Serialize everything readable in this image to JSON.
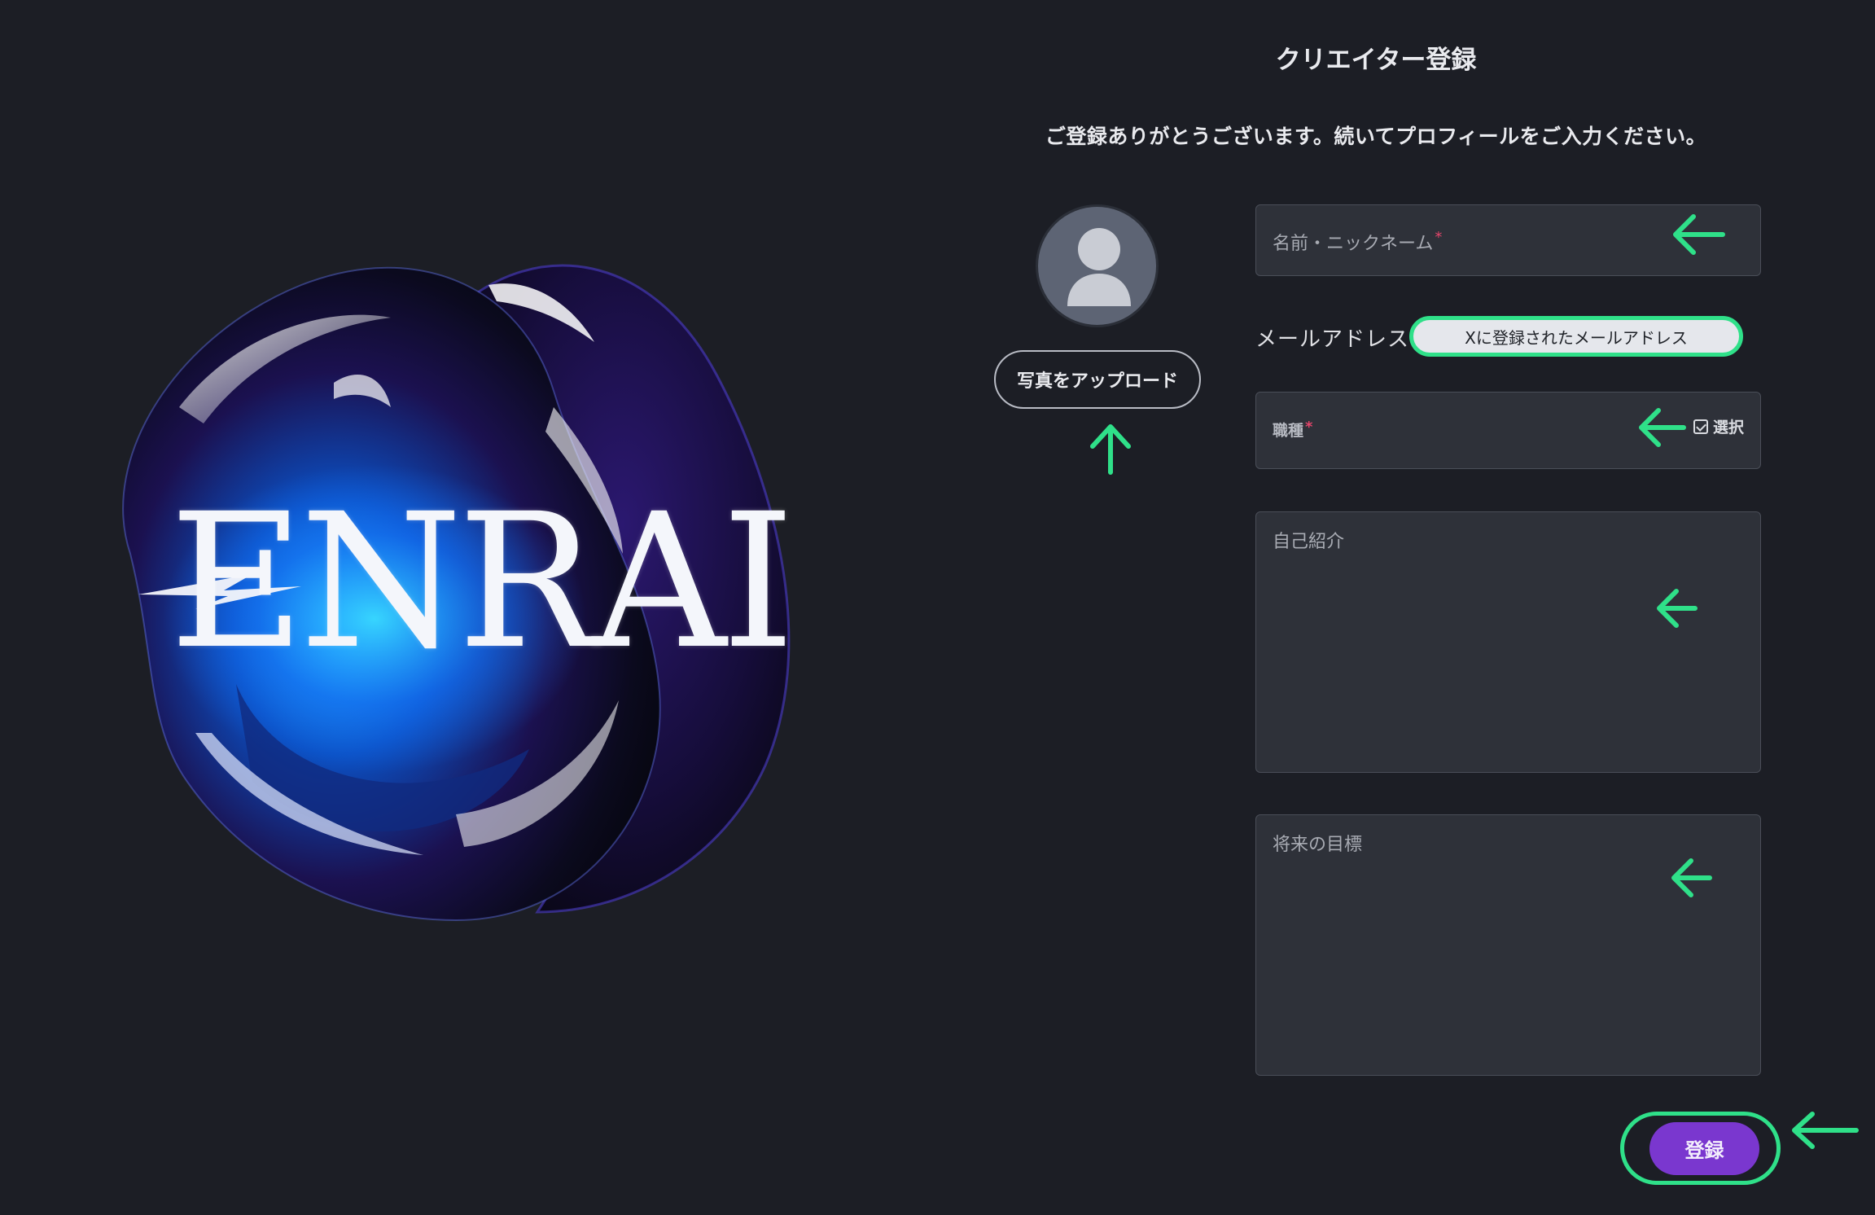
{
  "page": {
    "title": "クリエイター登録",
    "subtitle": "ご登録ありがとうございます。続いてプロフィールをご入力ください。"
  },
  "hero": {
    "logo_text": "ENRAI"
  },
  "profile_photo": {
    "avatar_icon": "user-silhouette-icon",
    "upload_label": "写真をアップロード"
  },
  "form": {
    "name_placeholder": "名前・ニックネーム",
    "name_required_mark": "*",
    "email_label": "メールアドレス",
    "email_value": "Xに登録されたメールアドレス",
    "occupation_label": "職種",
    "occupation_required_mark": "*",
    "occupation_select_label": "選択",
    "bio_placeholder": "自己紹介",
    "goal_placeholder": "将来の目標",
    "submit_label": "登録"
  },
  "colors": {
    "background": "#1c1e25",
    "field_background": "#2e3139",
    "accent_purple": "#7a37cf",
    "annotation_green": "#2fe089",
    "required_red": "#e2456a"
  }
}
